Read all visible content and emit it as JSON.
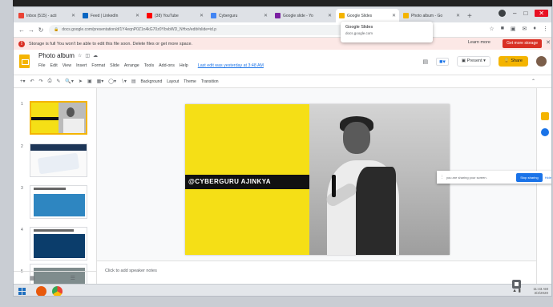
{
  "browser": {
    "tabs": [
      {
        "label": "Inbox (515) - acti",
        "favicon_color": "#ea4335",
        "active": false
      },
      {
        "label": "Feed | LinkedIn",
        "favicon_color": "#0a66c2",
        "active": false
      },
      {
        "label": "(38) YouTube",
        "favicon_color": "#ff0000",
        "active": false
      },
      {
        "label": "Cyberguru",
        "favicon_color": "#4285f4",
        "active": false
      },
      {
        "label": "Google slide - Yo",
        "favicon_color": "#7b1fa2",
        "active": false
      },
      {
        "label": "Google Slides",
        "favicon_color": "#f4b400",
        "active": true
      },
      {
        "label": "Photo album - Go",
        "favicon_color": "#f4b400",
        "active": false
      }
    ],
    "new_tab": "+",
    "url": "docs.google.com/presentation/d/1Y4eqnP0Z1n4kG70z0YbvbWD_NHxo/edit#slide=id.p"
  },
  "tooltip": {
    "title": "Google Slides",
    "subtitle": "docs.google.com"
  },
  "banner": {
    "message": "Storage is full  You won't be able to edit this file soon. Delete files or get more space.",
    "learn_more": "Learn more",
    "get_storage": "Get more storage"
  },
  "doc": {
    "title": "Photo album",
    "menus": [
      "File",
      "Edit",
      "View",
      "Insert",
      "Format",
      "Slide",
      "Arrange",
      "Tools",
      "Add-ons",
      "Help"
    ],
    "last_edit": "Last edit was yesterday at 3:48 AM",
    "present_label": "Present",
    "share_label": "Share"
  },
  "toolbar": {
    "background": "Background",
    "layout": "Layout",
    "theme": "Theme",
    "transition": "Transition"
  },
  "filmstrip": {
    "slide_numbers": [
      "1",
      "2",
      "3",
      "4",
      "5"
    ]
  },
  "slide": {
    "handle_text": "@CYBERGURU AJINKYA",
    "bg_color": "#f5df16"
  },
  "sharing": {
    "message": "you are sharing your screen.",
    "stop_label": "Stop sharing",
    "hide_label": "Hide"
  },
  "notes": {
    "placeholder": "Click to add speaker notes"
  },
  "taskbar": {
    "time": "11:43 AM",
    "date": "3/4/2020"
  }
}
